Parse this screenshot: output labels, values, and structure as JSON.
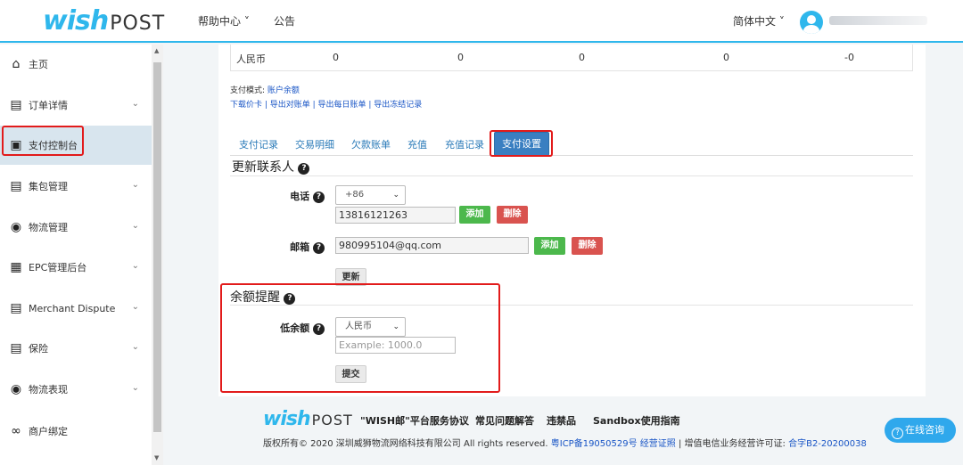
{
  "header": {
    "logo_wish": "wish",
    "logo_post": "POST",
    "help_center": "帮助中心 ˅",
    "notice": "公告",
    "language": "简体中文 ˅",
    "accent": "#2fb7ec"
  },
  "sidebar": {
    "items": [
      {
        "label": "主页",
        "icon": "home-icon"
      },
      {
        "label": "订单详情",
        "icon": "clipboard-icon"
      },
      {
        "label": "支付控制台",
        "icon": "credit-card-icon"
      },
      {
        "label": "集包管理",
        "icon": "clipboard-icon"
      },
      {
        "label": "物流管理",
        "icon": "globe-icon"
      },
      {
        "label": "EPC管理后台",
        "icon": "e-badge-icon"
      },
      {
        "label": "Merchant Dispute",
        "icon": "clipboard-icon"
      },
      {
        "label": "保险",
        "icon": "clipboard-icon"
      },
      {
        "label": "物流表现",
        "icon": "globe-icon"
      },
      {
        "label": "商户绑定",
        "icon": "link-icon"
      }
    ]
  },
  "balance_row": {
    "currency": "人民币",
    "values": [
      "0",
      "0",
      "0",
      "0",
      "-0"
    ]
  },
  "payment": {
    "mode_label": "支付模式: ",
    "mode_value": "账户余额",
    "links": "下载价卡 | 导出对账单 | 导出每日账单 | 导出冻结记录"
  },
  "tabs": [
    "支付记录",
    "交易明细",
    "欠款账单",
    "充值",
    "充值记录",
    "支付设置"
  ],
  "contact": {
    "title": "更新联系人",
    "phone_label": "电话",
    "country_code": "+86",
    "phone_value": "13816121263",
    "add_label": "添加",
    "delete_label": "删除",
    "email_label": "邮箱",
    "email_value": "980995104@qq.com",
    "update_label": "更新"
  },
  "balance_alert": {
    "title": "余额提醒",
    "low_label": "低余额",
    "currency": "人民币",
    "amount_placeholder": "Example: 1000.0",
    "submit_label": "提交"
  },
  "footer": {
    "links": [
      "\"WISH邮\"平台服务协议",
      "常见问题解答",
      "违禁品",
      "Sandbox使用指南"
    ],
    "copyright_prefix": "版权所有© 2020 深圳威狮物流网络科技有限公司 All rights reserved. ",
    "icp": "粤ICP备19050529号 经营证照",
    "license_mid": " | 增值电信业务经营许可证: ",
    "license_value": "合字B2-20200038",
    "chat_label": "在线咨询"
  }
}
